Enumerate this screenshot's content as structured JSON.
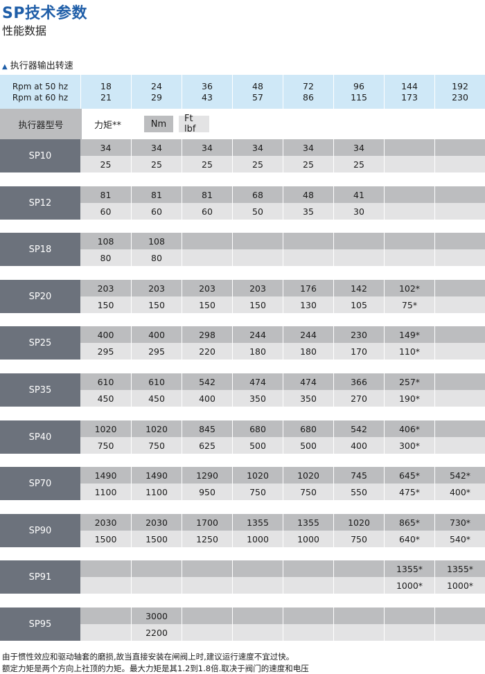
{
  "title": "SP技术参数",
  "subtitle": "性能数据",
  "section": "执行器输出转速",
  "rpm": {
    "label_50": "Rpm at 50 hz",
    "label_60": "Rpm at 60 hz",
    "hz50": [
      "18",
      "24",
      "36",
      "48",
      "72",
      "96",
      "144",
      "192"
    ],
    "hz60": [
      "21",
      "29",
      "43",
      "57",
      "86",
      "115",
      "173",
      "230"
    ]
  },
  "header": {
    "model_label": "执行器型号",
    "torque_label": "力矩**",
    "unit_nm": "Nm",
    "unit_ft": "Ft lbf"
  },
  "models": [
    {
      "name": "SP10",
      "nm": [
        "34",
        "34",
        "34",
        "34",
        "34",
        "34",
        "",
        ""
      ],
      "ft": [
        "25",
        "25",
        "25",
        "25",
        "25",
        "25",
        "",
        ""
      ]
    },
    {
      "name": "SP12",
      "nm": [
        "81",
        "81",
        "81",
        "68",
        "48",
        "41",
        "",
        ""
      ],
      "ft": [
        "60",
        "60",
        "60",
        "50",
        "35",
        "30",
        "",
        ""
      ]
    },
    {
      "name": "SP18",
      "nm": [
        "108",
        "108",
        "",
        "",
        "",
        "",
        "",
        ""
      ],
      "ft": [
        "80",
        "80",
        "",
        "",
        "",
        "",
        "",
        ""
      ]
    },
    {
      "name": "SP20",
      "nm": [
        "203",
        "203",
        "203",
        "203",
        "176",
        "142",
        "102*",
        ""
      ],
      "ft": [
        "150",
        "150",
        "150",
        "150",
        "130",
        "105",
        "75*",
        ""
      ]
    },
    {
      "name": "SP25",
      "nm": [
        "400",
        "400",
        "298",
        "244",
        "244",
        "230",
        "149*",
        ""
      ],
      "ft": [
        "295",
        "295",
        "220",
        "180",
        "180",
        "170",
        "110*",
        ""
      ]
    },
    {
      "name": "SP35",
      "nm": [
        "610",
        "610",
        "542",
        "474",
        "474",
        "366",
        "257*",
        ""
      ],
      "ft": [
        "450",
        "450",
        "400",
        "350",
        "350",
        "270",
        "190*",
        ""
      ]
    },
    {
      "name": "SP40",
      "nm": [
        "1020",
        "1020",
        "845",
        "680",
        "680",
        "542",
        "406*",
        ""
      ],
      "ft": [
        "750",
        "750",
        "625",
        "500",
        "500",
        "400",
        "300*",
        ""
      ]
    },
    {
      "name": "SP70",
      "nm": [
        "1490",
        "1490",
        "1290",
        "1020",
        "1020",
        "745",
        "645*",
        "542*"
      ],
      "ft": [
        "1100",
        "1100",
        "950",
        "750",
        "750",
        "550",
        "475*",
        "400*"
      ]
    },
    {
      "name": "SP90",
      "nm": [
        "2030",
        "2030",
        "1700",
        "1355",
        "1355",
        "1020",
        "865*",
        "730*"
      ],
      "ft": [
        "1500",
        "1500",
        "1250",
        "1000",
        "1000",
        "750",
        "640*",
        "540*"
      ]
    },
    {
      "name": "SP91",
      "nm": [
        "",
        "",
        "",
        "",
        "",
        "",
        "1355*",
        "1355*"
      ],
      "ft": [
        "",
        "",
        "",
        "",
        "",
        "",
        "1000*",
        "1000*"
      ]
    },
    {
      "name": "SP95",
      "nm": [
        "",
        "3000",
        "",
        "",
        "",
        "",
        "",
        ""
      ],
      "ft": [
        "",
        "2200",
        "",
        "",
        "",
        "",
        "",
        ""
      ]
    }
  ],
  "footnotes": [
    "由于惯性效应和驱动轴套的磨损,故当直接安装在闸阀上时,建议运行速度不宜过快。",
    "额定力矩是两个方向上社顶的力矩。最大力矩是其1.2到1.8倍.取决于阀门的速度和电压"
  ]
}
